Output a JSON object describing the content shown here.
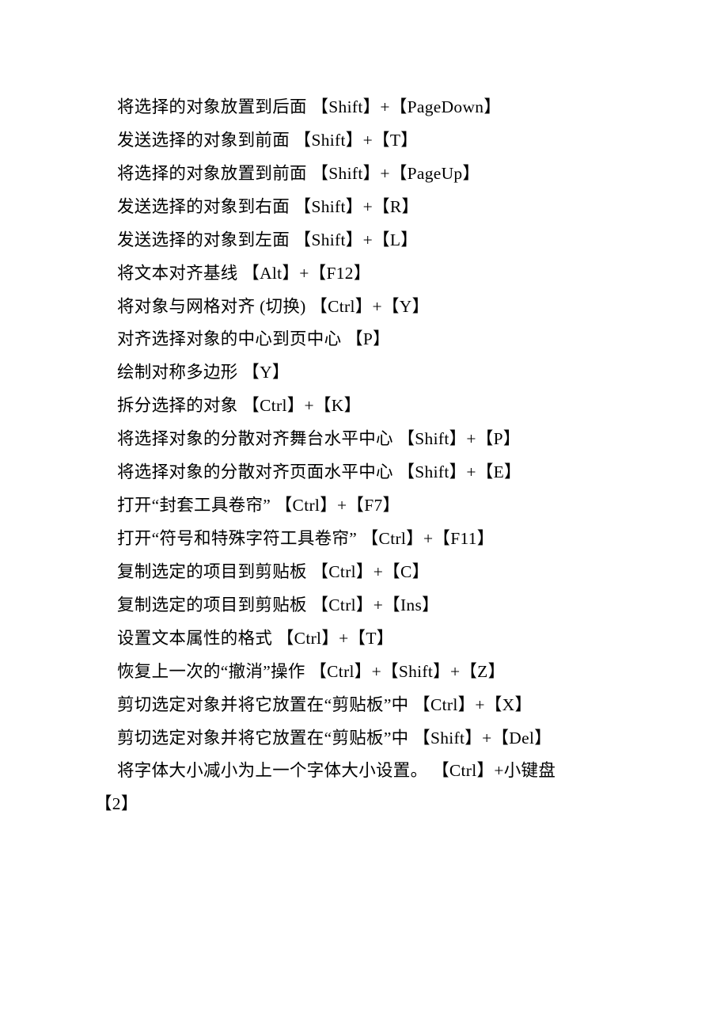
{
  "lines": [
    {
      "text": "将选择的对象放置到后面 【Shift】+【PageDown】",
      "indent": true
    },
    {
      "text": "发送选择的对象到前面 【Shift】+【T】",
      "indent": true
    },
    {
      "text": "将选择的对象放置到前面 【Shift】+【PageUp】",
      "indent": true
    },
    {
      "text": "发送选择的对象到右面 【Shift】+【R】",
      "indent": true
    },
    {
      "text": "发送选择的对象到左面 【Shift】+【L】",
      "indent": true
    },
    {
      "text": "将文本对齐基线 【Alt】+【F12】",
      "indent": true
    },
    {
      "text": "将对象与网格对齐 (切换) 【Ctrl】+【Y】",
      "indent": true
    },
    {
      "text": "对齐选择对象的中心到页中心 【P】",
      "indent": true
    },
    {
      "text": "绘制对称多边形 【Y】",
      "indent": true
    },
    {
      "text": "拆分选择的对象 【Ctrl】+【K】",
      "indent": true
    },
    {
      "text": "将选择对象的分散对齐舞台水平中心 【Shift】+【P】",
      "indent": true
    },
    {
      "text": "将选择对象的分散对齐页面水平中心 【Shift】+【E】",
      "indent": true
    },
    {
      "text": "打开“封套工具卷帘” 【Ctrl】+【F7】",
      "indent": true
    },
    {
      "text": "打开“符号和特殊字符工具卷帘” 【Ctrl】+【F11】",
      "indent": true
    },
    {
      "text": "复制选定的项目到剪贴板 【Ctrl】+【C】",
      "indent": true
    },
    {
      "text": "复制选定的项目到剪贴板 【Ctrl】+【Ins】",
      "indent": true
    },
    {
      "text": "设置文本属性的格式 【Ctrl】+【T】",
      "indent": true
    },
    {
      "text": "恢复上一次的“撤消”操作 【Ctrl】+【Shift】+【Z】",
      "indent": true
    },
    {
      "text": "剪切选定对象并将它放置在“剪贴板”中 【Ctrl】+【X】",
      "indent": true
    },
    {
      "text": "剪切选定对象并将它放置在“剪贴板”中 【Shift】+【Del】",
      "indent": true
    },
    {
      "text": "将字体大小减小为上一个字体大小设置。 【Ctrl】+小键盘",
      "indent": true
    },
    {
      "text": "【2】",
      "indent": false
    }
  ]
}
